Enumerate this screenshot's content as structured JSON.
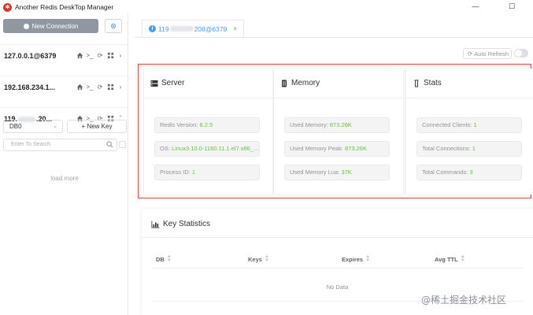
{
  "window": {
    "title": "Another Redis DeskTop Manager",
    "logo_icon": "redis-logo-icon"
  },
  "sidebar": {
    "new_connection_label": "New Connection",
    "connections": [
      {
        "name": "127.0.0.1@6379"
      },
      {
        "name": "192.168.234.1..."
      },
      {
        "name_prefix": "119.",
        "name_suffix": ".20..."
      }
    ],
    "db_select": {
      "value": "DB0"
    },
    "new_key_label": "+ New Key",
    "search_placeholder": "Enter To Search",
    "load_more_label": "load more"
  },
  "tab": {
    "prefix": "119",
    "suffix": "208@6379",
    "close_glyph": "×"
  },
  "toolbar": {
    "auto_refresh_label": "Auto Refresh",
    "auto_refresh_on": false
  },
  "cards": {
    "server": {
      "title": "Server",
      "items": [
        {
          "label": "Redis Version: ",
          "value": "6.2.5"
        },
        {
          "label": "OS: ",
          "value": "Linux3.10.0-1160.11.1.el7.x86_..."
        },
        {
          "label": "Process ID: ",
          "value": "1"
        }
      ]
    },
    "memory": {
      "title": "Memory",
      "items": [
        {
          "label": "Used Memory: ",
          "value": "873.26K"
        },
        {
          "label": "Used Memory Peak: ",
          "value": "873.26K"
        },
        {
          "label": "Used Memory Lua: ",
          "value": "37K"
        }
      ]
    },
    "stats": {
      "title": "Stats",
      "items": [
        {
          "label": "Connected Clients: ",
          "value": "1"
        },
        {
          "label": "Total Connections: ",
          "value": "1"
        },
        {
          "label": "Total Commands: ",
          "value": "3"
        }
      ]
    }
  },
  "key_statistics": {
    "title": "Key Statistics",
    "columns": [
      "DB",
      "Keys",
      "Expires",
      "Avg TTL"
    ],
    "empty_text": "No Data"
  },
  "watermark": "@稀土掘金技术社区",
  "colors": {
    "accent": "#409eff",
    "value_green": "#67c23a",
    "highlight_red": "#e03a3a"
  }
}
